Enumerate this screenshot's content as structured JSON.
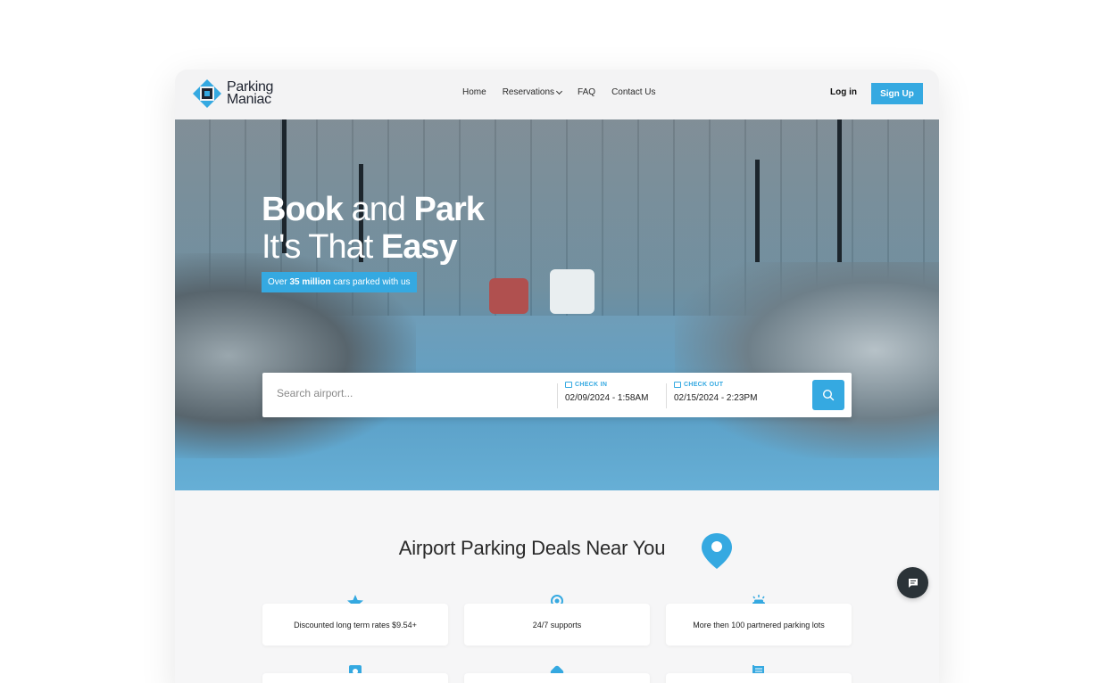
{
  "brand": {
    "line1": "Parking",
    "line2": "Maniac"
  },
  "nav": {
    "home": "Home",
    "reservations": "Reservations",
    "faq": "FAQ",
    "contact": "Contact Us",
    "login": "Log in",
    "signup": "Sign Up"
  },
  "hero": {
    "title_bold1": "Book",
    "title_light1": "and",
    "title_bold2": "Park",
    "title_light2": "It's That",
    "title_bold3": "Easy",
    "badge_prefix": "Over",
    "badge_bold": "35 million",
    "badge_suffix": "cars parked with us"
  },
  "search": {
    "placeholder": "Search airport...",
    "checkin_label": "CHECK IN",
    "checkin_value": "02/09/2024 - 1:58AM",
    "checkout_label": "CHECK OUT",
    "checkout_value": "02/15/2024 - 2:23PM"
  },
  "deals": {
    "title": "Airport Parking Deals Near You",
    "features": [
      {
        "label": "Discounted long term rates $9.54+",
        "icon": "star-icon"
      },
      {
        "label": "24/7 supports",
        "icon": "support-icon"
      },
      {
        "label": "More then 100 partnered parking lots",
        "icon": "car-icon"
      }
    ]
  },
  "colors": {
    "accent": "#35a9e1",
    "dark": "#2b3338"
  }
}
